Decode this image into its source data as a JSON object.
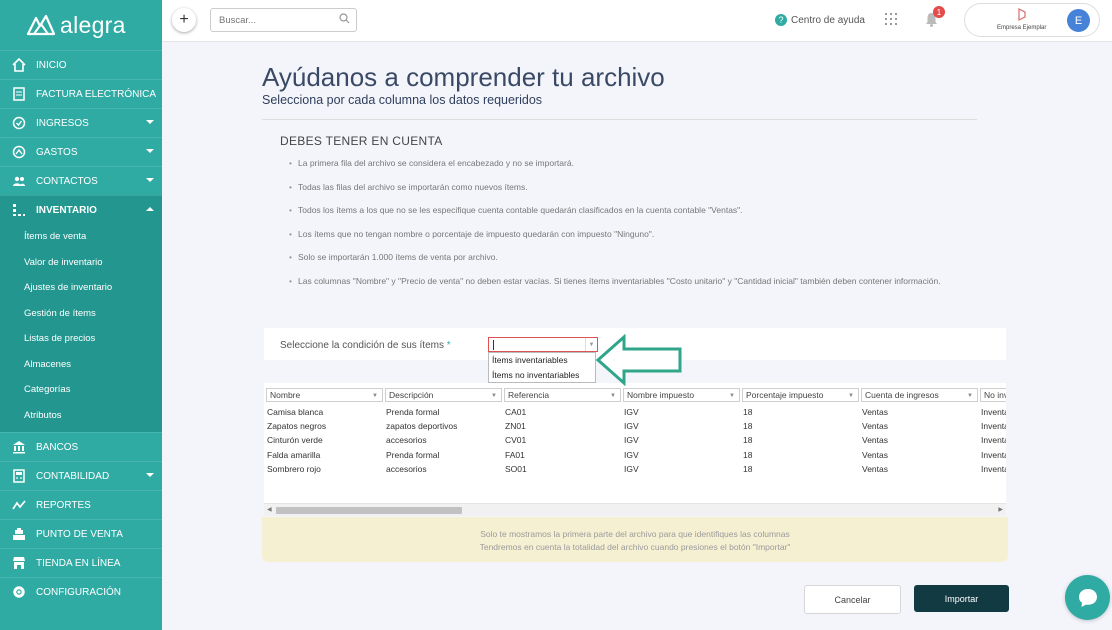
{
  "brand": {
    "name": "alegra",
    "accent": "#30aba4"
  },
  "sidebar": {
    "items": [
      {
        "label": "INICIO",
        "icon": "home-icon"
      },
      {
        "label": "FACTURA ELECTRÓNICA",
        "icon": "invoice-icon"
      },
      {
        "label": "INGRESOS",
        "icon": "income-icon",
        "has_caret": true
      },
      {
        "label": "GASTOS",
        "icon": "expenses-icon",
        "has_caret": true
      },
      {
        "label": "CONTACTOS",
        "icon": "contacts-icon",
        "has_caret": true
      },
      {
        "label": "INVENTARIO",
        "icon": "inventory-icon",
        "has_caret": true,
        "active": true
      }
    ],
    "subitems": [
      "Ítems de venta",
      "Valor de inventario",
      "Ajustes de inventario",
      "Gestión de ítems",
      "Listas de precios",
      "Almacenes",
      "Categorías",
      "Atributos"
    ],
    "items_after": [
      {
        "label": "BANCOS",
        "icon": "bank-icon"
      },
      {
        "label": "CONTABILIDAD",
        "icon": "accounting-icon",
        "has_caret": true
      },
      {
        "label": "REPORTES",
        "icon": "reports-icon"
      },
      {
        "label": "PUNTO DE VENTA",
        "icon": "pos-icon"
      },
      {
        "label": "TIENDA EN LÍNEA",
        "icon": "store-icon"
      },
      {
        "label": "CONFIGURACIÓN",
        "icon": "gear-icon"
      }
    ]
  },
  "topbar": {
    "search_placeholder": "Buscar...",
    "help_label": "Centro de ayuda",
    "notifications_count": "1",
    "company_name": "Empresa Ejemplar",
    "avatar_initial": "E"
  },
  "main": {
    "title": "Ayúdanos a comprender tu archivo",
    "subtitle": "Selecciona por cada columna los datos requeridos",
    "notice_heading": "DEBES TENER EN CUENTA",
    "notices": [
      "La primera fila del archivo se considera el encabezado y no se importará.",
      "Todas las filas del archivo se importarán como nuevos ítems.",
      "Todos los ítems a los que no se les especifique cuenta contable quedarán clasificados en la cuenta contable \"Ventas\".",
      "Los ítems que no tengan nombre o porcentaje de impuesto quedarán con impuesto \"Ninguno\".",
      "Solo se importarán 1.000 ítems de venta por archivo.",
      "Las columnas \"Nombre\" y \"Precio de venta\" no deben estar vacías. Si tienes ítems inventariables \"Costo unitario\" y \"Cantidad inicial\" también deben contener información."
    ],
    "condition_label": "Seleccione la condición de sus ítems",
    "condition_required": "*",
    "condition_options": [
      "Ítems inventariables",
      "Ítems no inventariables"
    ],
    "table": {
      "headers": [
        "Nombre",
        "Descripción",
        "Referencia",
        "Nombre impuesto",
        "Porcentaje impuesto",
        "Cuenta de ingresos",
        "No inventariables"
      ],
      "rows": [
        [
          "Camisa blanca",
          "Prenda formal",
          "CA01",
          "IGV",
          "18",
          "Ventas",
          "Inventariables"
        ],
        [
          "Zapatos negros",
          "zapatos deportivos",
          "ZN01",
          "IGV",
          "18",
          "Ventas",
          "Inventariables"
        ],
        [
          "Cinturón verde",
          "accesorios",
          "CV01",
          "IGV",
          "18",
          "Ventas",
          "Inventariables"
        ],
        [
          "Falda amarilla",
          "Prenda formal",
          "FA01",
          "IGV",
          "18",
          "Ventas",
          "Inventariables"
        ],
        [
          "Sombrero rojo",
          "accesorios",
          "SO01",
          "IGV",
          "18",
          "Ventas",
          "Inventariables"
        ]
      ]
    },
    "info_lines": [
      "Solo te mostramos la primera parte del archivo para que identifiques las columnas",
      "Tendremos en cuenta la totalidad del archivo cuando presiones el botón \"Importar\""
    ],
    "cancel_label": "Cancelar",
    "import_label": "Importar"
  }
}
